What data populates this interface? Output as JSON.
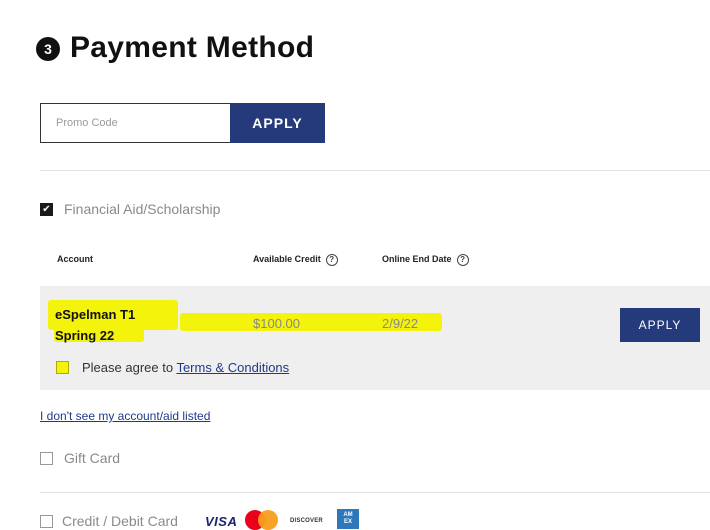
{
  "header": {
    "step_number": "3",
    "title": "Payment Method"
  },
  "promo": {
    "placeholder": "Promo Code",
    "apply_label": "APPLY"
  },
  "financial_aid": {
    "checked": true,
    "label": "Financial Aid/Scholarship",
    "columns": {
      "account": "Account",
      "available_credit": "Available Credit",
      "online_end_date": "Online End Date",
      "help_glyph": "?"
    },
    "row": {
      "account_line1": "eSpelman T1",
      "account_line2": "Spring 22",
      "available_credit": "$100.00",
      "online_end_date": "2/9/22",
      "apply_label": "APPLY"
    },
    "agree": {
      "text": "Please agree to ",
      "link": "Terms & Conditions"
    },
    "not_listed_link": "I don't see my account/aid listed"
  },
  "gift_card": {
    "label": "Gift Card"
  },
  "credit_card": {
    "label": "Credit / Debit Card",
    "logos": {
      "visa": "VISA",
      "discover": "DISCOVER",
      "amex_line1": "AM",
      "amex_line2": "EX"
    }
  }
}
